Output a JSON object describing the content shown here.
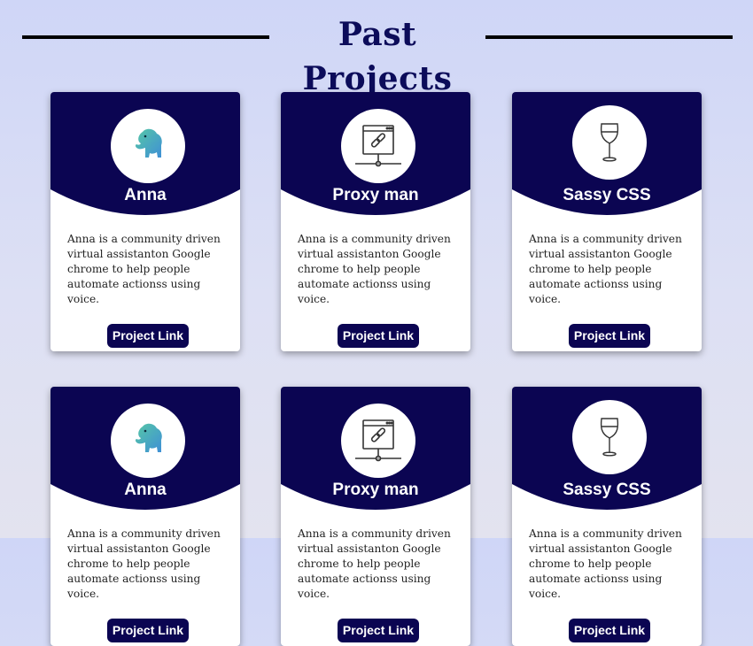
{
  "header": {
    "title": "Past Projects"
  },
  "colors": {
    "card_header": "#0b0552",
    "title": "#0c0c5a",
    "elephant": "#4fb3a4"
  },
  "cards": [
    {
      "icon": "elephant-icon",
      "title": "Anna",
      "description": "Anna is a community driven virtual assistanton Google chrome to help people automate actionss using voice.",
      "link_label": "Project Link"
    },
    {
      "icon": "proxy-link-icon",
      "title": "Proxy man",
      "description": "Anna is a community driven virtual assistanton Google chrome to help people automate actionss using voice.",
      "link_label": "Project Link"
    },
    {
      "icon": "wine-glass-icon",
      "title": "Sassy CSS",
      "description": "Anna is a community driven virtual assistanton Google chrome to help people automate actionss using voice.",
      "link_label": "Project Link"
    },
    {
      "icon": "elephant-icon",
      "title": "Anna",
      "description": "Anna is a community driven virtual assistanton Google chrome to help people automate actionss using voice.",
      "link_label": "Project Link"
    },
    {
      "icon": "proxy-link-icon",
      "title": "Proxy man",
      "description": "Anna is a community driven virtual assistanton Google chrome to help people automate actionss using voice.",
      "link_label": "Project Link"
    },
    {
      "icon": "wine-glass-icon",
      "title": "Sassy CSS",
      "description": "Anna is a community driven virtual assistanton Google chrome to help people automate actionss using voice.",
      "link_label": "Project Link"
    }
  ]
}
